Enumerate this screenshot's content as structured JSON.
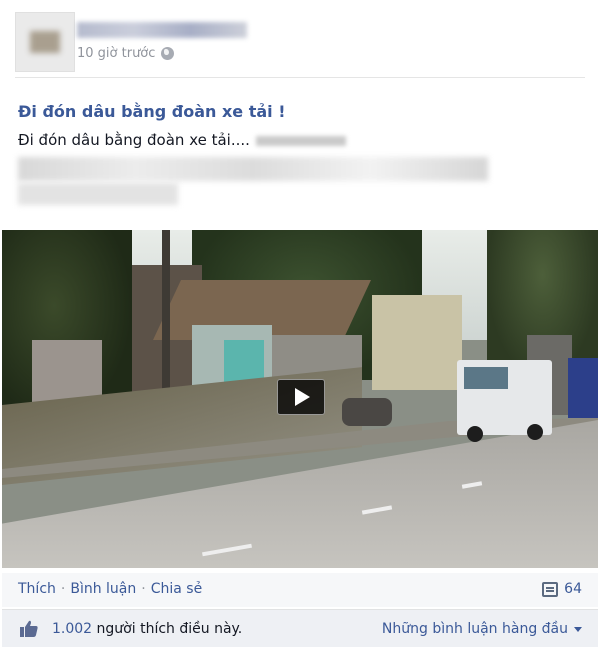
{
  "post": {
    "time": "10 giờ trước",
    "privacy_icon": "globe-icon"
  },
  "link": {
    "title": "Đi đón dâu bằng đoàn xe tải !",
    "description": "Đi đón dâu bằng đoàn xe tải...."
  },
  "video": {
    "play_icon": "play-icon"
  },
  "actions": {
    "like": "Thích",
    "comment": "Bình luận",
    "share": "Chia sẻ",
    "comment_count": "64"
  },
  "likes": {
    "count": "1.002",
    "text": "người thích điều này.",
    "top_comments": "Những bình luận hàng đầu"
  },
  "colors": {
    "link_blue": "#3b5998",
    "meta_gray": "#90949c",
    "bar_bg": "#f6f7f9"
  }
}
